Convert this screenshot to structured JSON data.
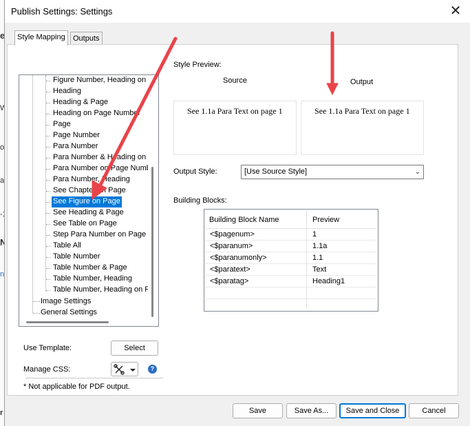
{
  "background": {
    "fragments": [
      "e",
      "W",
      "o",
      "a",
      "-1",
      "N",
      "n",
      "r"
    ]
  },
  "dialog": {
    "title": "Publish Settings: Settings",
    "close_symbol": "✕"
  },
  "tabs": [
    {
      "label": "Style Mapping",
      "active": true
    },
    {
      "label": "Outputs",
      "active": false
    }
  ],
  "tree": {
    "children": [
      "Figure Number, Heading on",
      "Heading",
      "Heading & Page",
      "Heading on Page Number",
      "Page",
      "Page Number",
      "Para Number",
      "Para Number & Heading on P",
      "Para Number on Page Numb",
      "Para Number, Heading",
      "See Chapter on Page",
      "See Figure on Page",
      "See Heading & Page",
      "See Table on Page",
      "Step Para Number on Page N",
      "Table All",
      "Table Number",
      "Table Number & Page",
      "Table Number, Heading",
      "Table Number, Heading on P"
    ],
    "selected": "See Figure on Page",
    "roots": [
      "Image Settings",
      "General Settings"
    ]
  },
  "style_preview": {
    "label": "Style Preview:",
    "source_label": "Source",
    "output_label": "Output",
    "source_text": "See 1.1a Para Text on page 1",
    "output_text": "See 1.1a Para Text on page 1"
  },
  "output_style": {
    "label": "Output Style:",
    "value": "[Use Source Style]"
  },
  "building_blocks": {
    "label": "Building Blocks:",
    "columns": [
      "Building Block Name",
      "Preview"
    ],
    "rows": [
      [
        "<$pagenum>",
        "1"
      ],
      [
        "<$paranum>",
        "1.1a"
      ],
      [
        "<$paranumonly>",
        "1.1"
      ],
      [
        "<$paratext>",
        "Text"
      ],
      [
        "<$paratag>",
        "Heading1"
      ]
    ]
  },
  "template": {
    "label": "Use Template:",
    "button": "Select"
  },
  "manage_css": {
    "label": "Manage CSS:",
    "help": "?"
  },
  "footnote": "* Not applicable for PDF output.",
  "buttons": {
    "save": "Save",
    "save_as": "Save As...",
    "save_close": "Save and Close",
    "cancel": "Cancel"
  },
  "colors": {
    "selection": "#0078d7",
    "arrow": "#e8444a"
  },
  "icons": {
    "close": "close-icon",
    "dropdown": "chevron-down-icon",
    "css": "tools-icon",
    "help": "help-icon"
  }
}
